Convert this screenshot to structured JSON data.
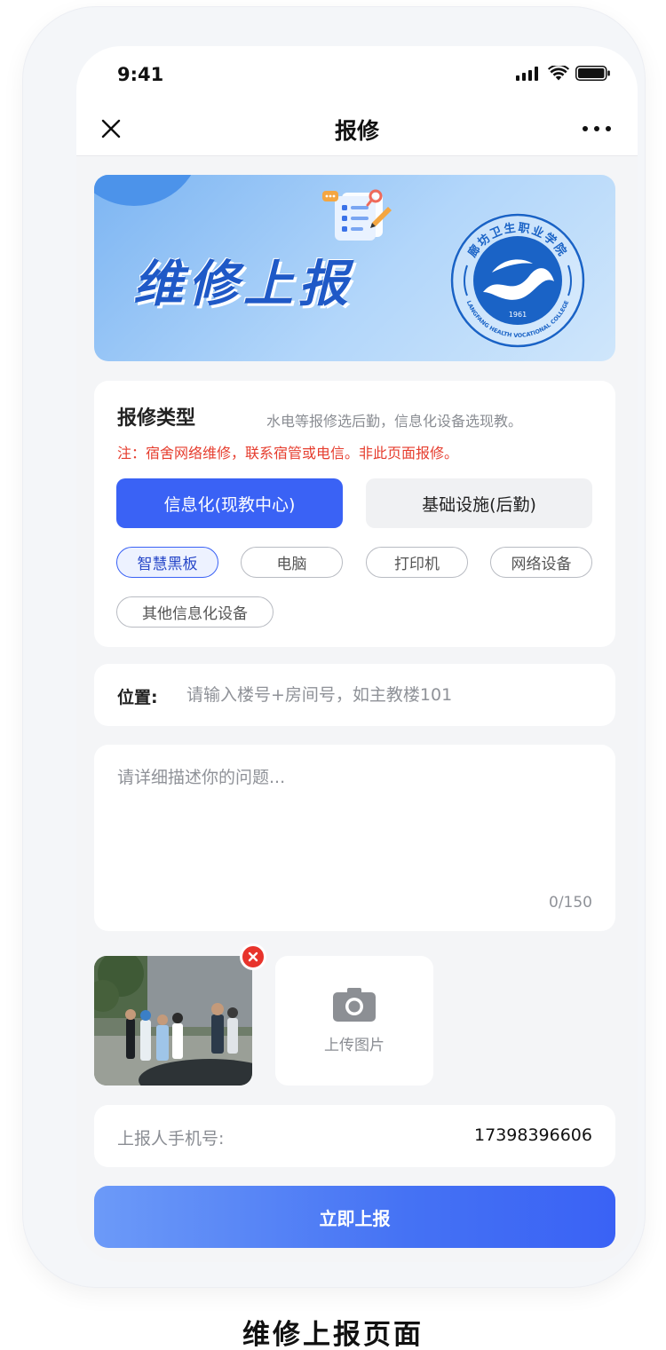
{
  "status_bar": {
    "time": "9:41"
  },
  "nav": {
    "title": "报修"
  },
  "banner": {
    "title": "维修上报",
    "logo_text": "廊坊卫生职业学院",
    "logo_english": "LANGFANG HEALTH VOCATIONAL COLLEGE",
    "logo_year": "1961"
  },
  "repair_type": {
    "title": "报修类型",
    "hint": "水电等报修选后勤，信息化设备选现教。",
    "note": "注：宿舍网络维修，联系宿管或电信。非此页面报修。",
    "categories": [
      {
        "label": "信息化(现教中心)",
        "selected": true
      },
      {
        "label": "基础设施(后勤)",
        "selected": false
      }
    ],
    "chips": [
      {
        "label": "智慧黑板",
        "selected": true
      },
      {
        "label": "电脑",
        "selected": false
      },
      {
        "label": "打印机",
        "selected": false
      },
      {
        "label": "网络设备",
        "selected": false
      },
      {
        "label": "其他信息化设备",
        "selected": false
      }
    ]
  },
  "location": {
    "label": "位置:",
    "placeholder": "请输入楼号+房间号，如主教楼101",
    "value": ""
  },
  "description": {
    "placeholder": "请详细描述你的问题...",
    "value": "",
    "counter": "0/150"
  },
  "upload": {
    "label": "上传图片"
  },
  "phone": {
    "label": "上报人手机号:",
    "value": "17398396606"
  },
  "submit": {
    "label": "立即上报"
  },
  "caption": "维修上报页面",
  "colors": {
    "primary": "#3a62f5",
    "warning": "#e63d2e",
    "banner_text": "#1f59c7",
    "logo_blue": "#1a63c6",
    "remove_red": "#e8342c"
  }
}
